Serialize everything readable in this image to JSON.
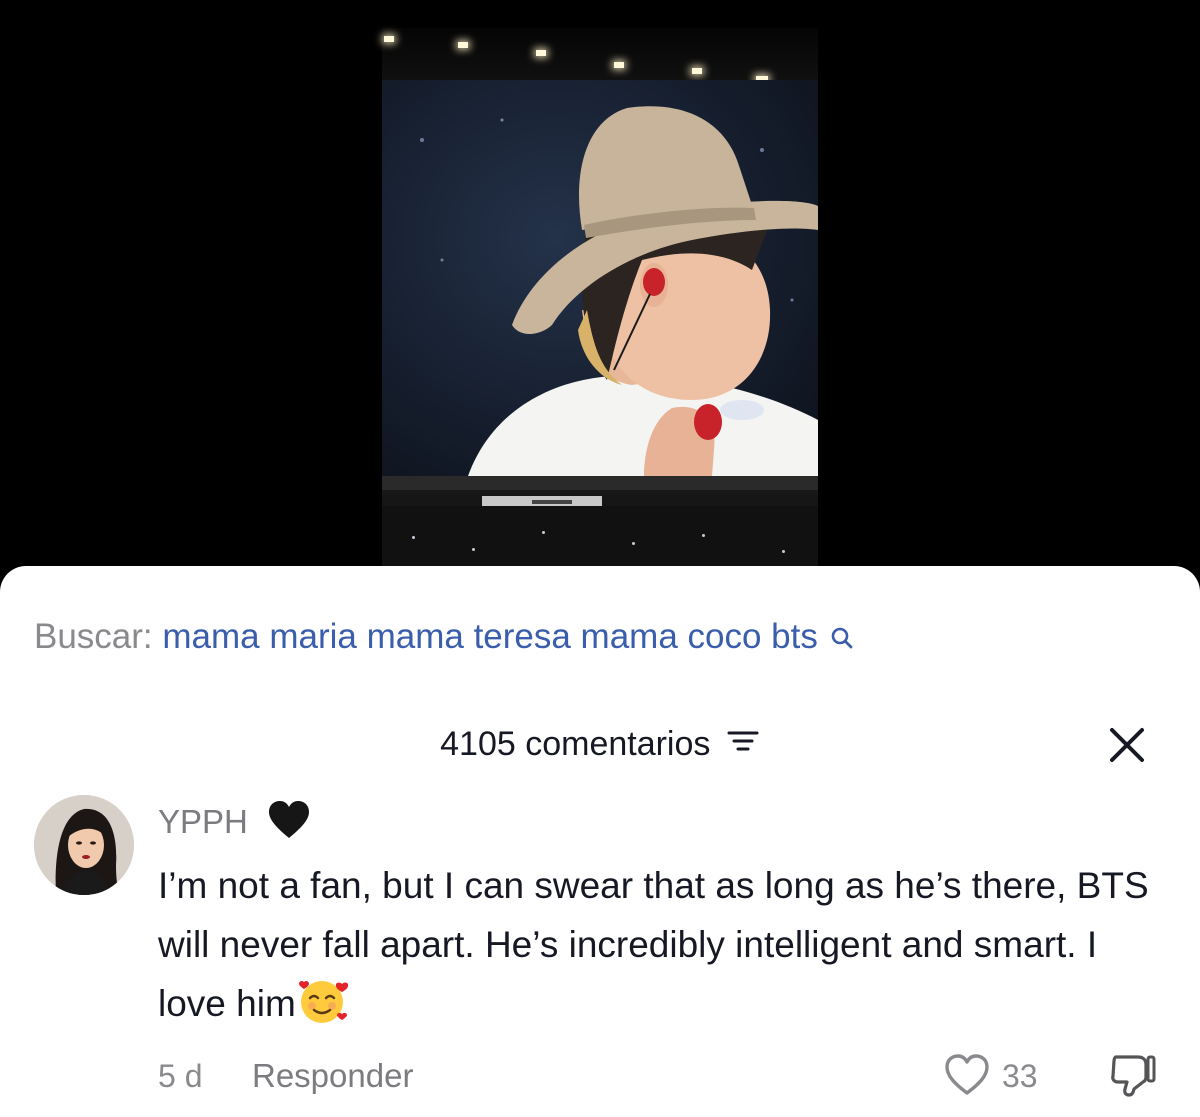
{
  "search": {
    "prefix": "Buscar:",
    "query": "mama maria mama teresa mama coco bts",
    "icon": "search-icon"
  },
  "comments": {
    "title": "4105 comentarios",
    "filter_icon": "filter-icon",
    "close_icon": "close-icon"
  },
  "comment": {
    "username": "YPPH",
    "username_emoji": "black-heart-icon",
    "text": "I’m not a fan, but I can swear that as long as he’s there, BTS will never fall apart. He’s incredibly intelligent and smart. I love him",
    "text_emoji": "smiling-face-with-hearts-icon",
    "time": "5 d",
    "reply_label": "Responder",
    "likes": "33",
    "like_icon": "heart-outline-icon",
    "dislike_icon": "thumbs-down-icon"
  },
  "colors": {
    "query_link": "#3a5eab",
    "muted_text": "#8a8a8e",
    "primary_text": "#161823"
  }
}
